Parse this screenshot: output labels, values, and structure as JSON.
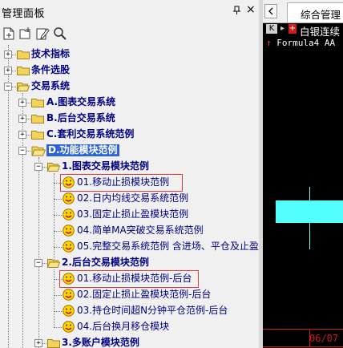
{
  "panel": {
    "title": "管理面板",
    "pin_icon": "pin-icon",
    "close_symbol": "×",
    "toolbar": [
      "new-file-icon",
      "new-folder-icon",
      "edit-icon",
      "search-icon"
    ]
  },
  "tree": {
    "root1": "技术指标",
    "root2": "条件选股",
    "root3": "交易系统",
    "trade_a": "A.图表交易系统",
    "trade_b": "B.后台交易系统",
    "trade_c": "C.套利交易系统范例",
    "trade_d": "D.功能模块范例",
    "sub1": "1.图表交易模块范例",
    "sub1_items": [
      "01.移动止损模块范例",
      "02.日内均线交易系统范例",
      "03.固定止损止盈模块范例",
      "04.简单MA突破交易系统范例",
      "05.完整交易系统范例 含进场、平仓及止盈"
    ],
    "sub2": "2.后台交易模块范例",
    "sub2_items": [
      "01.移动止损模块范例-后台",
      "02.固定止损止盈模块范例-后台",
      "03.持仓时间超N分钟平仓范例-后台",
      "04.后台换月移仓模块"
    ],
    "sub3": "3.多账户模块范例"
  },
  "right": {
    "tab_label": "综合管理",
    "chart_title": "白银连续",
    "formula": "Formula4 AA",
    "date": "06/07"
  },
  "colors": {
    "tree_text": "#000080",
    "selection": "#2c63d9",
    "highlight_box": "#e23a3a",
    "candle": "#54ffff",
    "chart_bg": "#000000"
  }
}
